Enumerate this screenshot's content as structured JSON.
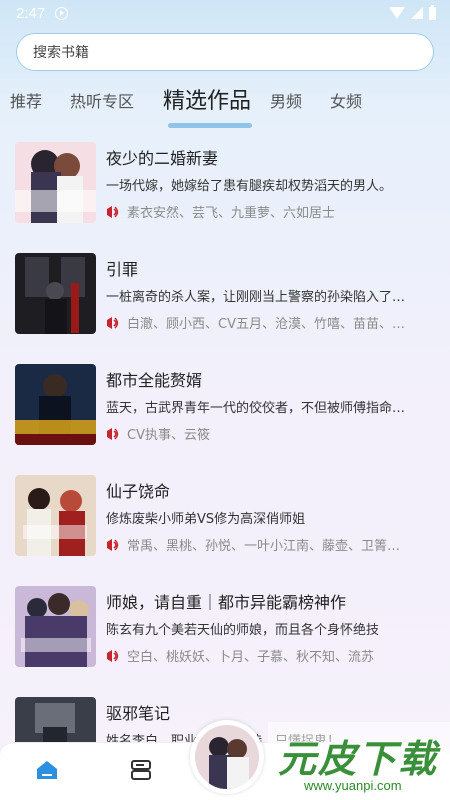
{
  "status": {
    "time": "2:47"
  },
  "search": {
    "placeholder": "搜索书籍"
  },
  "tabs": [
    {
      "label": "推荐"
    },
    {
      "label": "热听专区"
    },
    {
      "label": "精选作品"
    },
    {
      "label": "男频"
    },
    {
      "label": "女频"
    }
  ],
  "active_tab": "精选作品",
  "books": [
    {
      "title": "夜少的二婚新妻",
      "desc": "一场代嫁，她嫁给了患有腿疾却权势滔天的男人。",
      "narrators": "素衣安然、芸飞、九重萝、六如居士",
      "cover_text": "夜少的二婚新妻"
    },
    {
      "title": "引罪",
      "desc": "一桩离奇的杀人案，让刚刚当上警察的孙染陷入了…",
      "narrators": "白澈、顾小西、CV五月、沧漠、竹嘻、苗苗、…",
      "cover_text": "引罪"
    },
    {
      "title": "都市全能赘婿",
      "desc": "蓝天，古武界青年一代的佼佼者，不但被师傅指命…",
      "narrators": "CV执事、云筱",
      "cover_text": "全能赘婿"
    },
    {
      "title": "仙子饶命",
      "desc": "修炼废柴小师弟VS修为高深俏师姐",
      "narrators": "常禹、黑桃、孙悦、一叶小江南、藤壶、卫箐…",
      "cover_text": "仙子饶命"
    },
    {
      "title": "师娘，请自重｜都市异能霸榜神作",
      "desc": "陈玄有九个美若天仙的师娘，而且各个身怀绝技",
      "narrators": "空白、桃妖妖、卜月、子慕、秋不知、流苏",
      "cover_text": "师娘请自重"
    },
    {
      "title": "驱邪笔记",
      "desc": "姓名李白，职业…不会写诗，只懂捉鬼！",
      "narrators": "",
      "cover_text": ""
    }
  ],
  "watermark": {
    "main": "元皮下载",
    "url": "www.yuanpi.com"
  },
  "colors": {
    "accent": "#8fc3ea",
    "narrator_icon": "#c8242f",
    "nav_active": "#2d8fe0"
  }
}
